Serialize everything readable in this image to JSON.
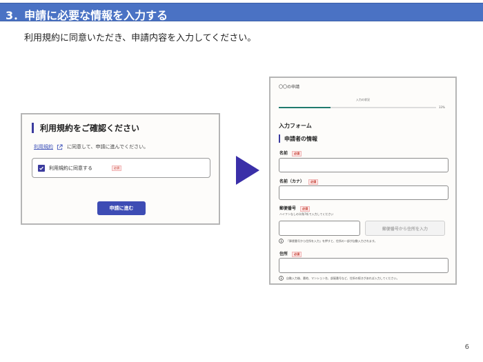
{
  "header": {
    "title": "3．申請に必要な情報を入力する"
  },
  "subtitle": "利用規約に同意いただき、申請内容を入力してください。",
  "page_number": "6",
  "terms_screen": {
    "heading": "利用規約をご確認ください",
    "link_label": "利用規約",
    "link_suffix": "に同意して、申請に進んでください。",
    "checkbox_label": "利用規約に同意する",
    "checkbox_checked": true,
    "required_badge": "必須",
    "proceed_button": "申請に進む"
  },
  "form_screen": {
    "app_title": "〇〇の申請",
    "progress_label": "入力の状況",
    "progress_percent": "33%",
    "progress_value": 0.33,
    "form_heading": "入力フォーム",
    "section_heading": "申請者の情報",
    "required_badge": "必須",
    "fields": {
      "name_label": "名前",
      "kana_label": "名前（カナ）",
      "postal_label": "郵便番号",
      "postal_hint": "ハイフンなしの半角7桁で入力してください",
      "postal_button": "郵便番号から住所を入力",
      "postal_info": "「郵便番号から住所を入力」を押すと、住所の一部が自動入力されます。",
      "address_label": "住所",
      "address_info": "自動入力後、番地、マンション名、部屋番号など、住所の続きがあれば入力してください。"
    }
  },
  "colors": {
    "header_bg": "#4a72c4",
    "accent": "#3b3b9e",
    "button": "#3d4cb4",
    "progress": "#1f7a6e",
    "arrow": "#3a2fa8"
  },
  "icons": {
    "external_link": "external-link-icon",
    "check": "check-icon",
    "arrow": "arrow-right-icon",
    "info": "info-icon"
  }
}
